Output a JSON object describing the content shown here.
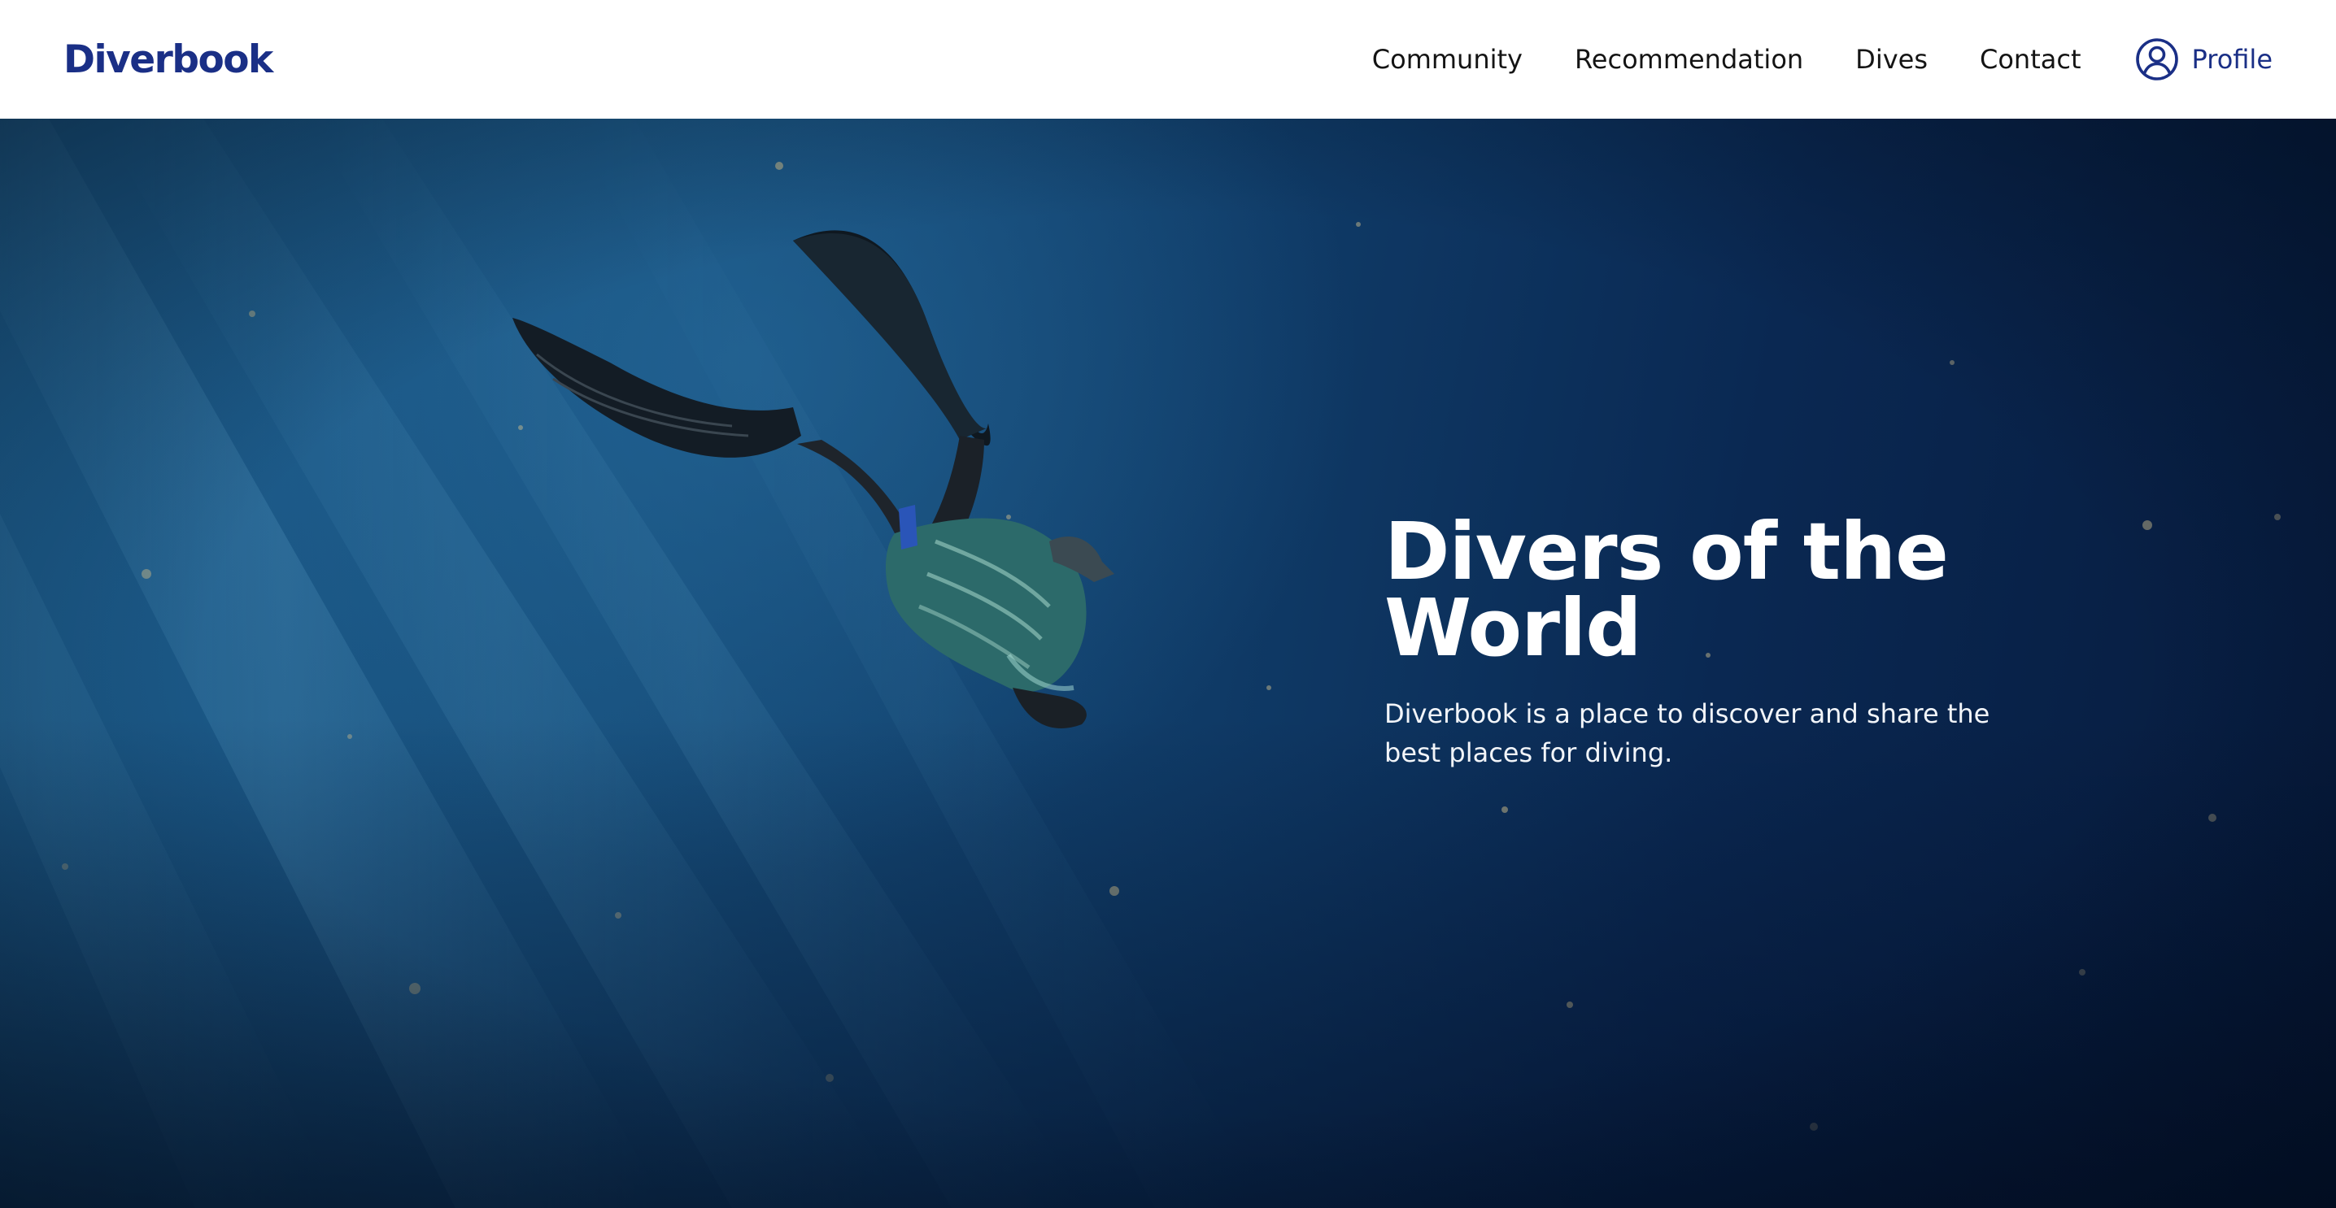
{
  "brand": {
    "name": "Diverbook",
    "color": "#1a2f86"
  },
  "nav": {
    "items": [
      {
        "label": "Community"
      },
      {
        "label": "Recommendation"
      },
      {
        "label": "Dives"
      },
      {
        "label": "Contact"
      }
    ],
    "profile": {
      "label": "Profile",
      "icon": "user-circle-icon"
    }
  },
  "hero": {
    "title": "Divers of the World",
    "description": "Diverbook is a place to discover and share the best places for diving.",
    "image": "freediver-underwater-with-fins"
  }
}
